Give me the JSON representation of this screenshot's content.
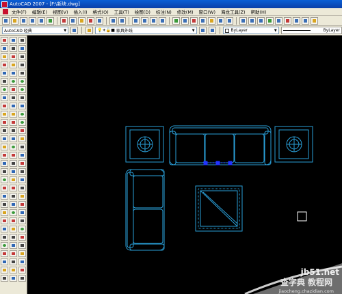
{
  "window": {
    "title": "AutoCAD 2007 - [F:\\新块.dwg]"
  },
  "menubar": {
    "items": [
      "文件(F)",
      "编辑(E)",
      "视图(V)",
      "插入(I)",
      "格式(O)",
      "工具(T)",
      "绘图(D)",
      "标注(N)",
      "修改(M)",
      "窗口(W)",
      "海龙工具(Z)",
      "帮助(H)"
    ]
  },
  "properties_bar": {
    "workspace": "AutoCAD 经典",
    "layer": "家具外线",
    "color": "ByLayer",
    "linetype": "ByLayer"
  },
  "watermark": {
    "site": "jb51.net",
    "brand": "查字典 教程网",
    "url": "jiaocheng.chazidian.com"
  },
  "colors": {
    "canvas_bg": "#000000",
    "furniture_line": "#2a9fd8",
    "grip": "#2233ff",
    "pickbox": "#ffffff"
  }
}
